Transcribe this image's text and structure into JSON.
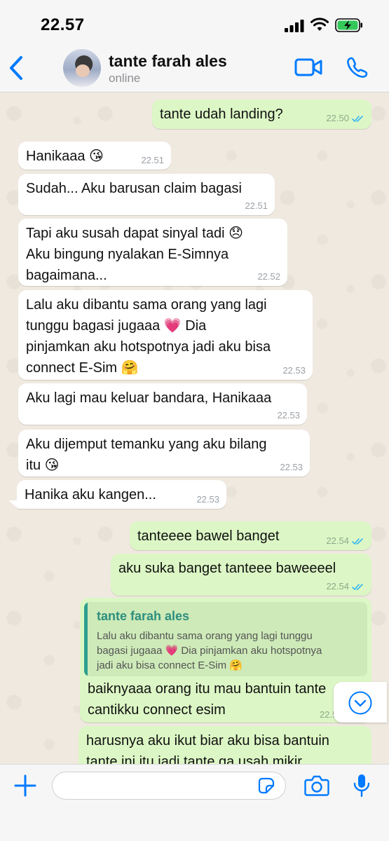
{
  "status_bar": {
    "time": "22.57",
    "icons": [
      "signal-icon",
      "wifi-icon",
      "battery-charging-icon"
    ]
  },
  "header": {
    "contact_name": "tante farah ales",
    "contact_status": "online",
    "icons": [
      "back-icon",
      "video-call-icon",
      "phone-call-icon"
    ],
    "accent_color": "#007aff"
  },
  "messages": [
    {
      "direction": "out",
      "text": "tante udah landing?",
      "time": "22.50",
      "read": true
    },
    {
      "direction": "in",
      "text": "Hanikaaa 😘",
      "time": "22.51"
    },
    {
      "direction": "in",
      "text": "Sudah... Aku barusan claim bagasi",
      "time": "22.51"
    },
    {
      "direction": "in",
      "text": "Tapi aku susah dapat sinyal tadi 😞\nAku bingung nyalakan E-Simnya\nbagaimana...",
      "time": "22.52"
    },
    {
      "direction": "in",
      "text": "Lalu aku dibantu sama orang yang lagi\ntunggu bagasi jugaaa 💗 Dia\npinjamkan aku hotspotnya jadi aku bisa\nconnect E-Sim 🤗",
      "time": "22.53"
    },
    {
      "direction": "in",
      "text": "Aku lagi mau keluar bandara, Hanikaaa",
      "time": "22.53"
    },
    {
      "direction": "in",
      "text": "Aku dijemput temanku yang aku bilang\nitu 😘",
      "time": "22.53"
    },
    {
      "direction": "in",
      "text": "Hanika aku kangen...",
      "time": "22.53"
    },
    {
      "direction": "out",
      "text": "tanteeee bawel banget",
      "time": "22.54",
      "read": true
    },
    {
      "direction": "out",
      "text": "aku suka banget tanteee baweeeel",
      "time": "22.54",
      "read": true
    },
    {
      "direction": "out",
      "quote": {
        "name": "tante farah ales",
        "text": "Lalu aku dibantu sama orang yang lagi tunggu\nbagasi jugaaa 💗 Dia pinjamkan aku hotspotnya\njadi aku bisa connect E-Sim 🤗"
      },
      "text": "baiknyaaa orang itu mau bantuin tante\ncantikku connect esim",
      "time": "22.55"
    },
    {
      "direction": "out",
      "text": "harusnya aku ikut biar aku bisa bantuin\ntante ini itu jadi tante ga usah mikir",
      "time": ""
    }
  ],
  "input": {
    "placeholder": "",
    "icons": [
      "plus-icon",
      "sticker-icon",
      "camera-icon",
      "microphone-icon"
    ]
  },
  "colors": {
    "incoming_bubble": "#ffffff",
    "outgoing_bubble": "#dcf7c5",
    "chat_background": "#efe9e0",
    "read_ticks": "#34b7f1"
  }
}
